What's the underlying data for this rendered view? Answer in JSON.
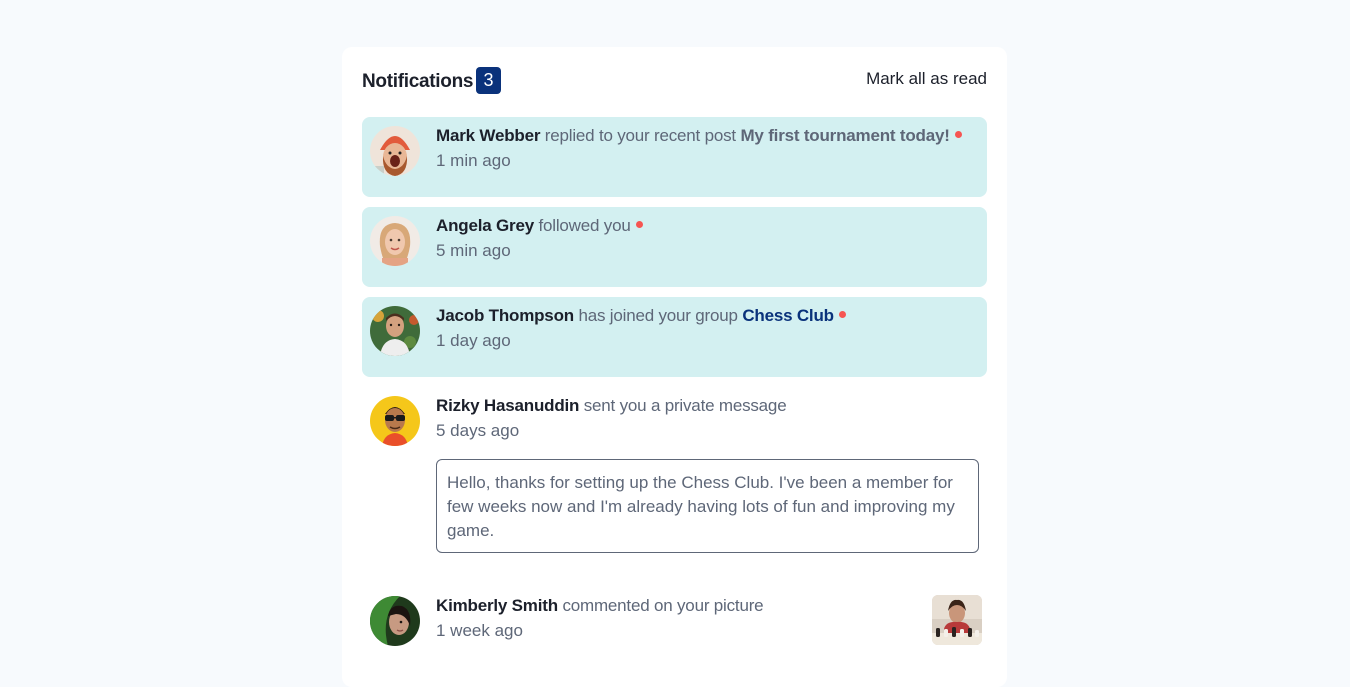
{
  "header": {
    "title": "Notifications",
    "unread_count": "3",
    "mark_all_label": "Mark all as read"
  },
  "notifications": [
    {
      "name": "Mark Webber",
      "action": "replied to your recent post",
      "target": "My first tournament today!",
      "time": "1 min ago",
      "unread": true
    },
    {
      "name": "Angela Grey",
      "action": "followed you",
      "time": "5 min ago",
      "unread": true
    },
    {
      "name": "Jacob Thompson",
      "action": "has joined your group",
      "target": "Chess Club",
      "time": "1 day ago",
      "unread": true
    },
    {
      "name": "Rizky Hasanuddin",
      "action": "sent you a private message",
      "time": "5 days ago",
      "unread": false,
      "message": "Hello, thanks for setting up the Chess Club. I've been a member for few weeks now and I'm already having lots of fun and improving my game."
    },
    {
      "name": "Kimberly Smith",
      "action": "commented on your picture",
      "time": "1 week ago",
      "unread": false
    }
  ],
  "colors": {
    "page_bg": "#f7fafd",
    "unread_bg": "#d3f0f1",
    "badge_bg": "#0a327b",
    "dot": "#f65552",
    "text_dark": "#1c202b",
    "text_muted": "#5e6778"
  }
}
